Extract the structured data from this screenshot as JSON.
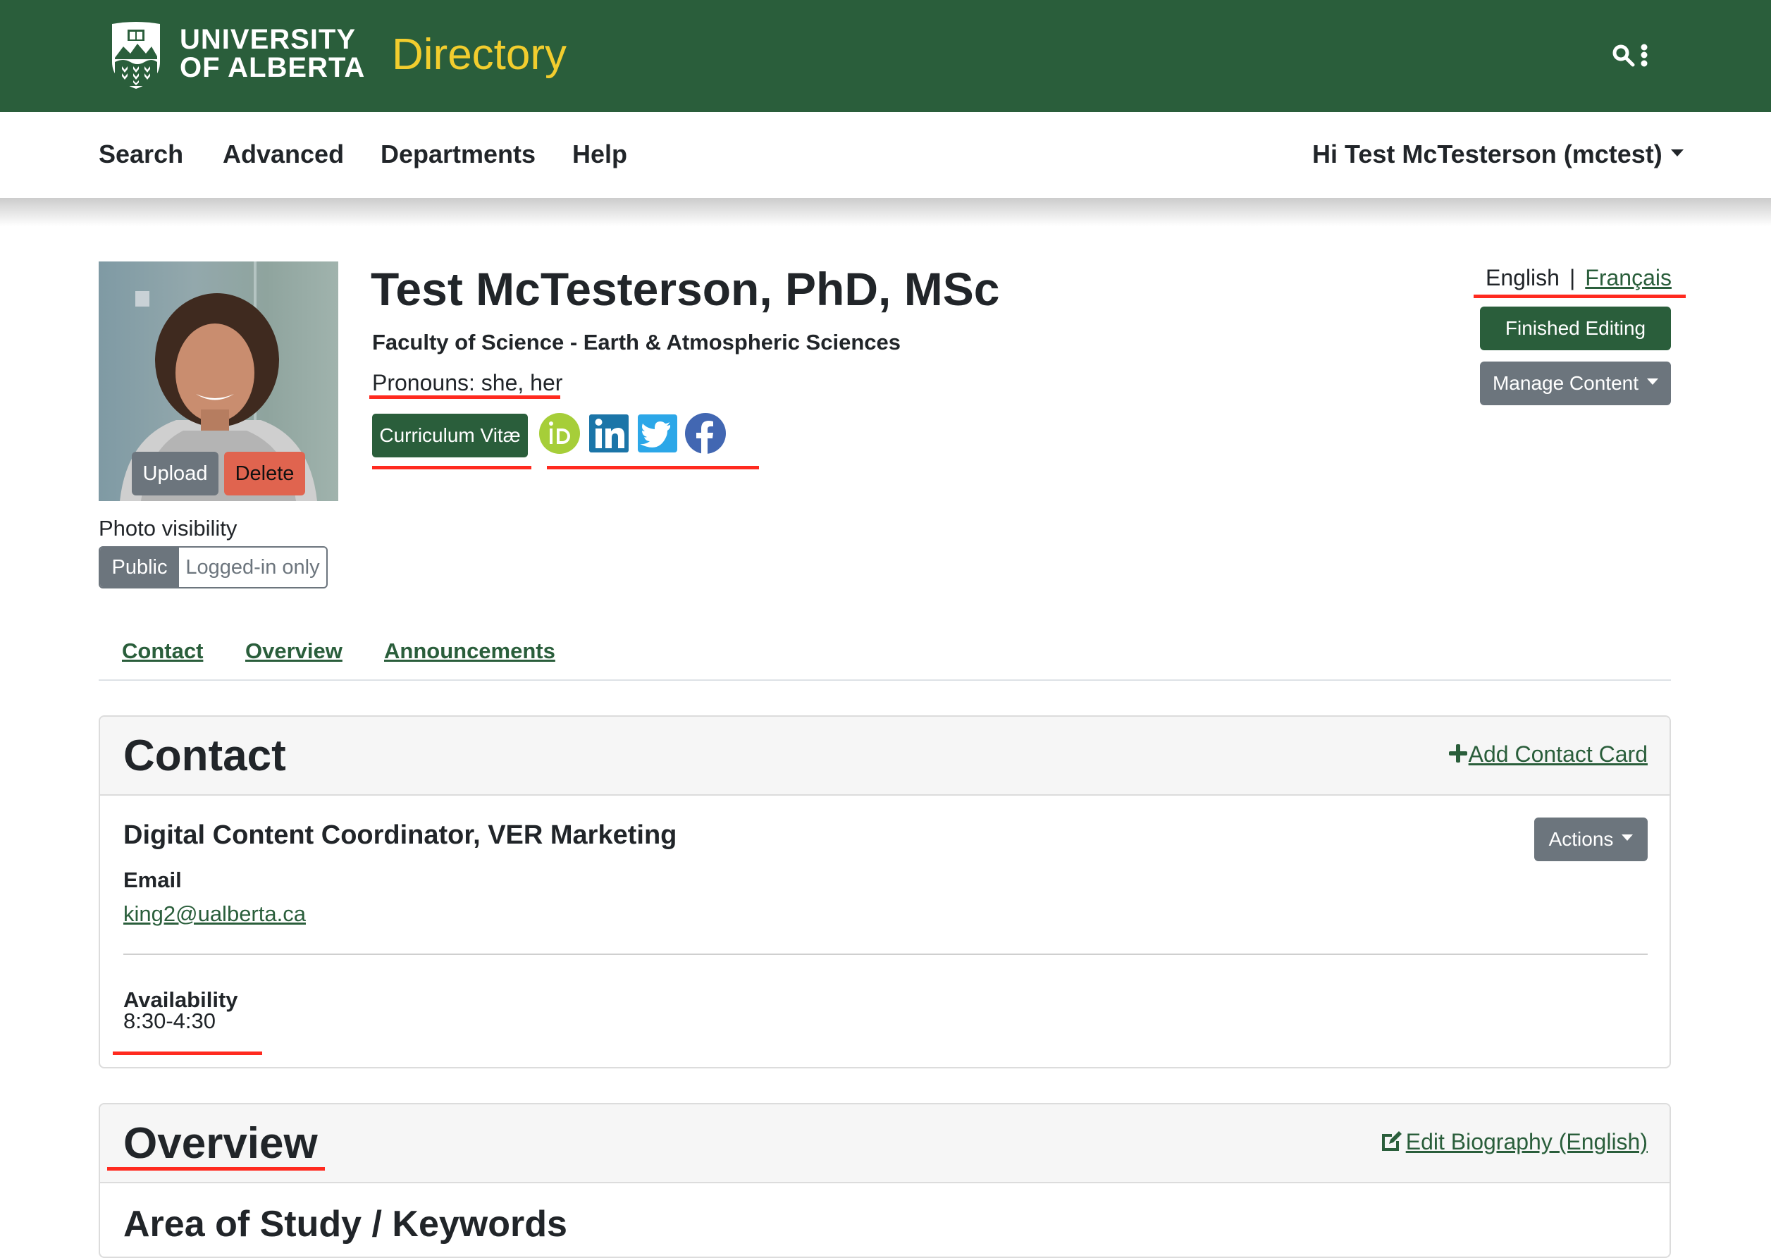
{
  "header": {
    "logo_line1": "UNIVERSITY",
    "logo_line2": "OF ALBERTA",
    "app_title": "Directory",
    "icons": [
      "shield-logo",
      "search-icon",
      "kebab-menu-icon"
    ],
    "colors": {
      "brand_green": "#2a5e3b",
      "brand_gold": "#f2cd2e"
    }
  },
  "nav": {
    "items": [
      {
        "label": "Search"
      },
      {
        "label": "Advanced"
      },
      {
        "label": "Departments"
      },
      {
        "label": "Help"
      }
    ],
    "user_menu": "Hi Test McTesterson (mctest)"
  },
  "profile": {
    "photo": {
      "upload_label": "Upload",
      "delete_label": "Delete",
      "visibility_label": "Photo visibility",
      "visibility_options": [
        "Public",
        "Logged-in only"
      ],
      "visibility_selected": "Public"
    },
    "name": "Test McTesterson, PhD, MSc",
    "faculty": "Faculty of Science - Earth & Atmospheric Sciences",
    "pronouns": "Pronouns: she, her",
    "cv_label": "Curriculum Vitæ",
    "social_links": [
      {
        "name": "ORCID",
        "icon": "orcid-icon",
        "color": "#a6ce39"
      },
      {
        "name": "LinkedIn",
        "icon": "linkedin-icon",
        "color": "#1b75a8"
      },
      {
        "name": "Twitter",
        "icon": "twitter-icon",
        "color": "#2ca7e8"
      },
      {
        "name": "Facebook",
        "icon": "facebook-icon",
        "color": "#4267b2"
      }
    ]
  },
  "language": {
    "current": "English",
    "separator": "|",
    "alternate": "Français"
  },
  "actions": {
    "finished_editing": "Finished Editing",
    "manage_content": "Manage Content"
  },
  "tabs": [
    {
      "label": "Contact"
    },
    {
      "label": "Overview"
    },
    {
      "label": "Announcements"
    }
  ],
  "contact_card": {
    "title": "Contact",
    "add_link": "Add Contact Card",
    "position": "Digital Content Coordinator, VER Marketing",
    "actions_label": "Actions",
    "email_label": "Email",
    "email": "king2@ualberta.ca",
    "availability_label": "Availability",
    "availability": "8:30-4:30"
  },
  "overview_card": {
    "title": "Overview",
    "edit_link": "Edit Biography (English)",
    "subheading": "Area of Study / Keywords"
  },
  "annotations": {
    "highlight_color": "#ff2a1f"
  }
}
